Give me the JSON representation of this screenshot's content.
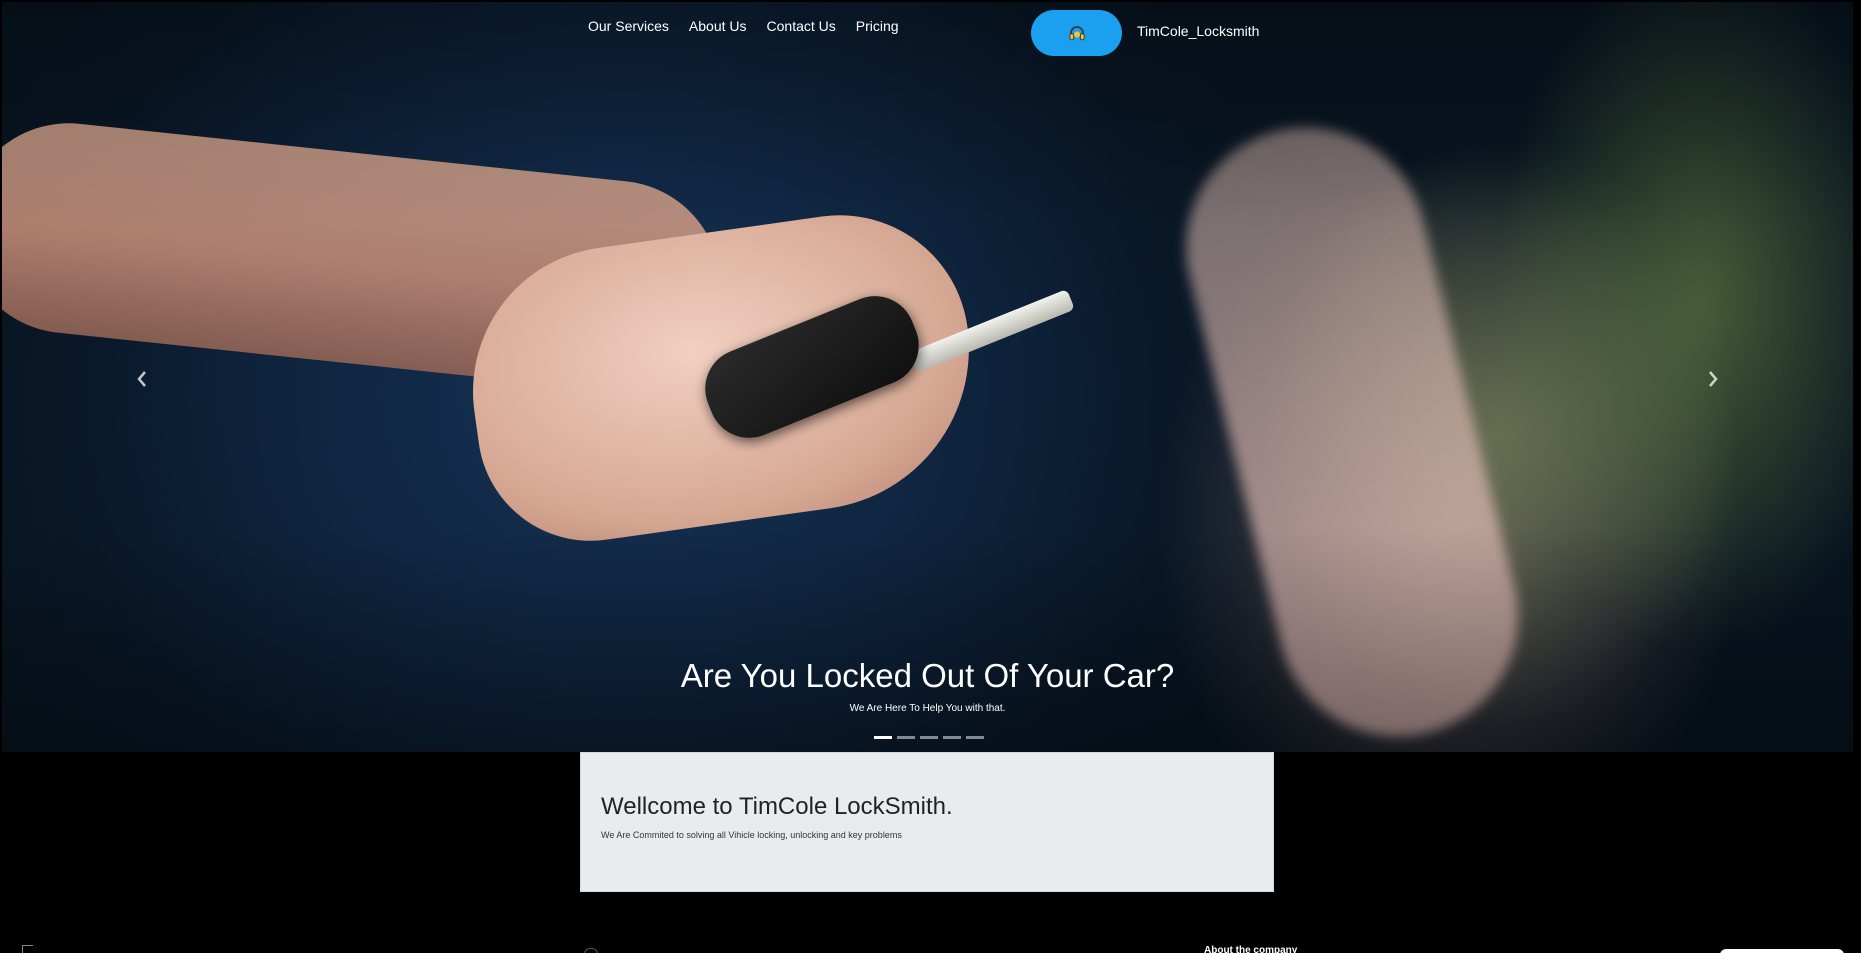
{
  "nav": {
    "items": [
      {
        "label": "Our Services"
      },
      {
        "label": "About Us"
      },
      {
        "label": "Contact Us"
      },
      {
        "label": "Pricing"
      }
    ]
  },
  "header": {
    "call_icon": "headset-icon",
    "brand": "TimCole_Locksmith",
    "accent_color": "#1aa0ee"
  },
  "carousel": {
    "title": "Are You Locked Out Of Your Car?",
    "subtitle": "We Are Here To Help You with that.",
    "prev_icon": "chevron-left-icon",
    "next_icon": "chevron-right-icon",
    "slide_count": 5,
    "active_slide": 1
  },
  "welcome": {
    "heading": "Wellcome to TimCole LockSmith.",
    "text": "We Are Commited to solving all Vihicle locking, unlocking and key problems"
  },
  "footer": {
    "about_heading": "About the company"
  }
}
